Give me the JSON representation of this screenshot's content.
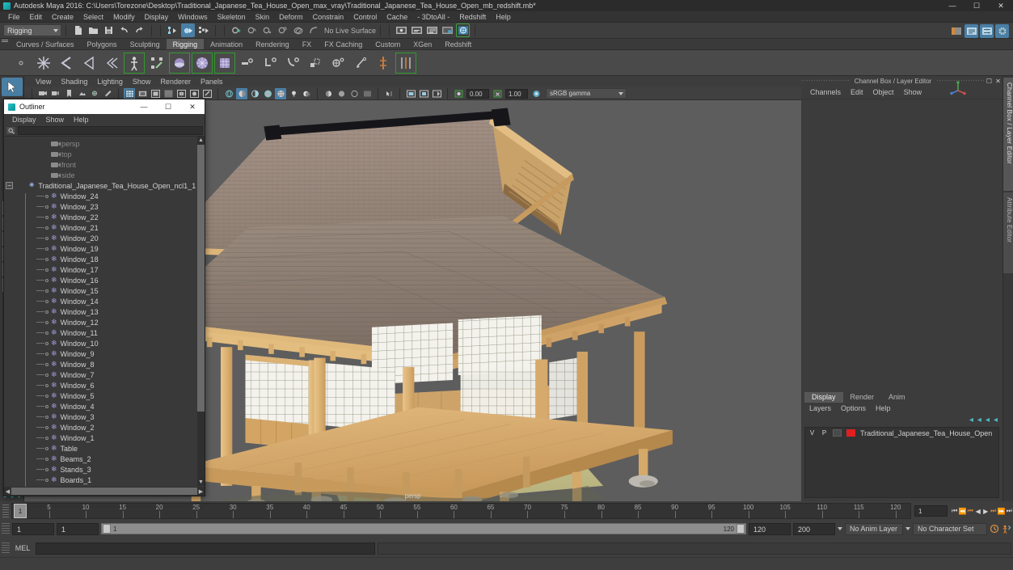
{
  "window": {
    "title": "Autodesk Maya 2016: C:\\Users\\Torezone\\Desktop\\Traditional_Japanese_Tea_House_Open_max_vray\\Traditional_Japanese_Tea_House_Open_mb_redshift.mb*",
    "minimize": "—",
    "maximize": "☐",
    "close": "✕"
  },
  "menubar": {
    "items": [
      "File",
      "Edit",
      "Create",
      "Select",
      "Modify",
      "Display",
      "Windows",
      "Skeleton",
      "Skin",
      "Deform",
      "Constrain",
      "Control",
      "Cache",
      "- 3DtoAll -",
      "Redshift",
      "Help"
    ]
  },
  "statusbar": {
    "mode": "Rigging",
    "live_surface_label": "No Live Surface"
  },
  "shelf": {
    "tabs": [
      "Curves / Surfaces",
      "Polygons",
      "Sculpting",
      "Rigging",
      "Animation",
      "Rendering",
      "FX",
      "FX Caching",
      "Custom",
      "XGen",
      "Redshift"
    ],
    "active_tab": "Rigging"
  },
  "viewport": {
    "menus": [
      "View",
      "Shading",
      "Lighting",
      "Show",
      "Renderer",
      "Panels"
    ],
    "exposure_value": "0.00",
    "gamma_value": "1.00",
    "color_space": "sRGB gamma",
    "camera_label": "persp",
    "background_color": "#5d5d5d"
  },
  "outliner": {
    "title": "Outliner",
    "minimize": "—",
    "maximize": "☐",
    "close": "✕",
    "menus": [
      "Display",
      "Show",
      "Help"
    ],
    "search_value": "",
    "cameras": [
      "persp",
      "top",
      "front",
      "side"
    ],
    "group": "Traditional_Japanese_Tea_House_Open_ncl1_1",
    "children": [
      "Window_24",
      "Window_23",
      "Window_22",
      "Window_21",
      "Window_20",
      "Window_19",
      "Window_18",
      "Window_17",
      "Window_16",
      "Window_15",
      "Window_14",
      "Window_13",
      "Window_12",
      "Window_11",
      "Window_10",
      "Window_9",
      "Window_8",
      "Window_7",
      "Window_6",
      "Window_5",
      "Window_4",
      "Window_3",
      "Window_2",
      "Window_1",
      "Table",
      "Beams_2",
      "Stands_3",
      "Boards_1"
    ]
  },
  "right_panel": {
    "title": "Channel Box / Layer Editor",
    "menus": [
      "Channels",
      "Edit",
      "Object",
      "Show"
    ],
    "vertical_tabs": [
      "Channel Box / Layer Editor",
      "Attribute Editor"
    ],
    "layer_editor": {
      "tabs": [
        "Display",
        "Render",
        "Anim"
      ],
      "active_tab": "Display",
      "menus": [
        "Layers",
        "Options",
        "Help"
      ],
      "columns": [
        "V",
        "P"
      ],
      "layers": [
        {
          "name": "Traditional_Japanese_Tea_House_Open",
          "color": "#e02020",
          "visible": "V",
          "playback": "P"
        }
      ]
    }
  },
  "timeline": {
    "ticks": [
      5,
      10,
      15,
      20,
      25,
      30,
      35,
      40,
      45,
      50,
      55,
      60,
      65,
      70,
      75,
      80,
      85,
      90,
      95,
      100,
      105,
      110,
      115,
      120
    ],
    "current_frame": "1",
    "frame_field": "1",
    "range_start": "1",
    "range_end": "1",
    "slider_start": "1",
    "slider_end": "120",
    "playback_end": "120",
    "anim_end": "200",
    "anim_layer": "No Anim Layer",
    "character_set": "No Character Set",
    "playback_buttons": [
      "⏮",
      "⏴",
      "◀|",
      "◀",
      "▶",
      "|▶",
      "⏵",
      "⏭"
    ]
  },
  "command_line": {
    "language": "MEL",
    "input_value": "",
    "output_value": ""
  },
  "model": {
    "name": "Traditional Japanese Tea House",
    "colors": {
      "wood_light": "#e0b778",
      "wood_mid": "#d2a263",
      "wood_dark": "#b8854c",
      "roof": "#9c8878",
      "roof_dark": "#7f6f62",
      "ridge": "#1c1c1c",
      "paper": "#f2f0ea",
      "tatami": "#c8c48e",
      "table": "#8a3f22",
      "stone": "#b9b5ad"
    }
  }
}
